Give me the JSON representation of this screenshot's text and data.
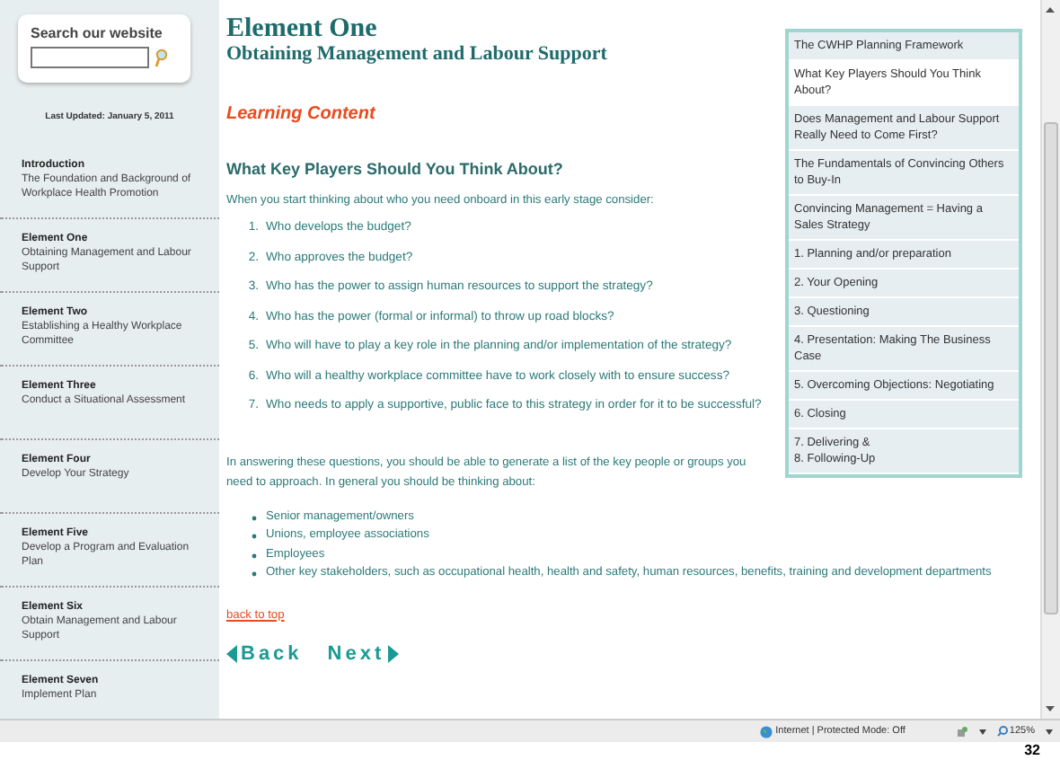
{
  "sidebar": {
    "search": {
      "title": "Search our website"
    },
    "last_updated": "Last Updated: January 5, 2011",
    "items": [
      {
        "title": "Introduction",
        "subtitle": "The Foundation and Background of Workplace Health Promotion"
      },
      {
        "title": "Element One",
        "subtitle": "Obtaining Management and Labour Support"
      },
      {
        "title": "Element Two",
        "subtitle": "Establishing a Healthy Workplace Committee"
      },
      {
        "title": "Element Three",
        "subtitle": "Conduct a Situational Assessment"
      },
      {
        "title": "Element Four",
        "subtitle": "Develop Your Strategy"
      },
      {
        "title": "Element Five",
        "subtitle": "Develop a Program and Evaluation Plan"
      },
      {
        "title": "Element Six",
        "subtitle": "Obtain Management and Labour Support"
      },
      {
        "title": "Element Seven",
        "subtitle": "Implement Plan"
      }
    ]
  },
  "content": {
    "title": "Element One",
    "subtitle": "Obtaining Management and Labour Support",
    "section_label": "Learning Content",
    "heading": "What Key Players Should You Think About?",
    "intro": "When you start thinking about who you need onboard in this early stage consider:",
    "questions": [
      {
        "number": "1.",
        "text": "Who develops the budget?"
      },
      {
        "number": "2.",
        "text": "Who approves the budget?"
      },
      {
        "number": "3.",
        "text": "Who has the power to assign human resources to support the strategy?"
      },
      {
        "number": "4.",
        "text": "Who has the power (formal or informal) to throw up road blocks?"
      },
      {
        "number": "5.",
        "text": "Who will have to play a key role in the planning and/or implementation of the strategy?"
      },
      {
        "number": "6.",
        "text": "Who will a healthy workplace committee have to work closely with to ensure success?"
      },
      {
        "number": "7.",
        "text": "Who needs to apply a supportive, public face to this strategy in order for it to be successful?"
      }
    ],
    "paragraph": "In answering these questions, you should be able to generate a list of the key people or groups you need to approach. In general you should be thinking about:",
    "bullets": [
      "Senior management/owners",
      "Unions, employee associations",
      "Employees",
      "Other key stakeholders, such as occupational health, health and safety, human resources, benefits, training and development departments"
    ],
    "back_to_top": "back to top",
    "back": "Back",
    "next": "Next"
  },
  "toc": [
    {
      "label": "The CWHP Planning Framework",
      "selected": false
    },
    {
      "label": "What Key Players Should You Think About?",
      "selected": true
    },
    {
      "label": "Does Management and Labour Support Really Need to Come First?",
      "selected": false
    },
    {
      "label": "The Fundamentals of Convincing Others to Buy-In",
      "selected": false
    },
    {
      "label": "Convincing Management = Having a Sales Strategy",
      "selected": false
    },
    {
      "label": "1. Planning and/or preparation",
      "selected": false
    },
    {
      "label": "2. Your Opening",
      "selected": false
    },
    {
      "label": "3. Questioning",
      "selected": false
    },
    {
      "label": "4. Presentation: Making The Business Case",
      "selected": false
    },
    {
      "label": "5. Overcoming Objections: Negotiating",
      "selected": false
    },
    {
      "label": "6. Closing",
      "selected": false
    },
    {
      "label": "7. Delivering &\n8. Following-Up",
      "selected": false
    }
  ],
  "status_bar": {
    "zone": "Internet | Protected Mode: Off",
    "zoom": "125%"
  },
  "page_number": "32"
}
